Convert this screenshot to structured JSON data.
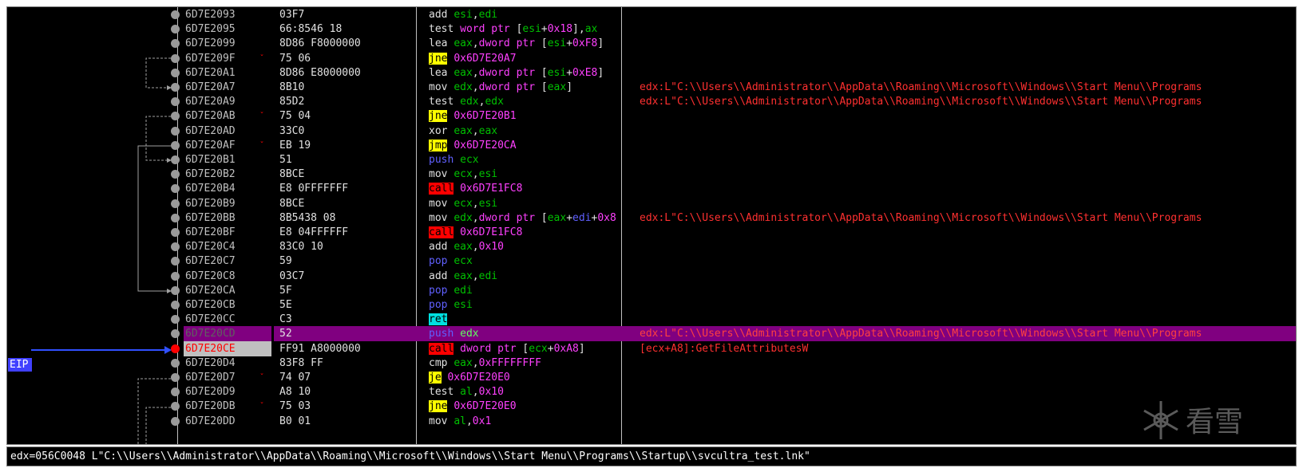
{
  "eip_label": "EIP",
  "watermark_text": "看雪",
  "status_bar": "edx=056C0048 L\"C:\\\\Users\\\\Administrator\\\\AppData\\\\Roaming\\\\Microsoft\\\\Windows\\\\Start Menu\\\\Programs\\\\Startup\\\\svcultra_test.lnk\"",
  "colors": {
    "background": "#000000",
    "selected_row": "#800080",
    "jump_highlight": "#ffff00",
    "call_highlight": "#ff0000",
    "ret_highlight": "#00e0e0",
    "comment": "#ff3030",
    "register": "#00c000",
    "immediate": "#ff40ff"
  },
  "rows": [
    {
      "addr": "6D7E2093",
      "bytes": "03F7",
      "mnemonic": "add",
      "mtype": "plain",
      "ops": [
        [
          "reg",
          "esi"
        ],
        [
          "txt",
          ","
        ],
        [
          "reg",
          "edi"
        ]
      ],
      "comment": ""
    },
    {
      "addr": "6D7E2095",
      "bytes": "66:8546 18",
      "mnemonic": "test",
      "mtype": "plain",
      "ops": [
        [
          "kw",
          "word ptr"
        ],
        [
          "txt",
          " ["
        ],
        [
          "reg",
          "esi"
        ],
        [
          "txt",
          "+"
        ],
        [
          "imm",
          "0x18"
        ],
        [
          "txt",
          "],"
        ],
        [
          "reg",
          "ax"
        ]
      ],
      "comment": ""
    },
    {
      "addr": "6D7E2099",
      "bytes": "8D86 F8000000",
      "mnemonic": "lea",
      "mtype": "plain",
      "ops": [
        [
          "reg",
          "eax"
        ],
        [
          "txt",
          ","
        ],
        [
          "kw",
          "dword ptr"
        ],
        [
          "txt",
          " ["
        ],
        [
          "reg",
          "esi"
        ],
        [
          "txt",
          "+"
        ],
        [
          "imm",
          "0xF8"
        ],
        [
          "txt",
          "]"
        ]
      ],
      "comment": ""
    },
    {
      "addr": "6D7E209F",
      "bytes": "75 06",
      "mnemonic": "jne",
      "mtype": "jcc",
      "jmark": true,
      "ops": [
        [
          "imm",
          "0x6D7E20A7"
        ]
      ],
      "comment": ""
    },
    {
      "addr": "6D7E20A1",
      "bytes": "8D86 E8000000",
      "mnemonic": "lea",
      "mtype": "plain",
      "ops": [
        [
          "reg",
          "eax"
        ],
        [
          "txt",
          ","
        ],
        [
          "kw",
          "dword ptr"
        ],
        [
          "txt",
          " ["
        ],
        [
          "reg",
          "esi"
        ],
        [
          "txt",
          "+"
        ],
        [
          "imm",
          "0xE8"
        ],
        [
          "txt",
          "]"
        ]
      ],
      "comment": ""
    },
    {
      "addr": "6D7E20A7",
      "bytes": "8B10",
      "mnemonic": "mov",
      "mtype": "plain",
      "ops": [
        [
          "reg",
          "edx"
        ],
        [
          "txt",
          ","
        ],
        [
          "kw",
          "dword ptr"
        ],
        [
          "txt",
          " ["
        ],
        [
          "reg",
          "eax"
        ],
        [
          "txt",
          "]"
        ]
      ],
      "comment": "edx:L\"C:\\\\Users\\\\Administrator\\\\AppData\\\\Roaming\\\\Microsoft\\\\Windows\\\\Start Menu\\\\Programs"
    },
    {
      "addr": "6D7E20A9",
      "bytes": "85D2",
      "mnemonic": "test",
      "mtype": "plain",
      "ops": [
        [
          "reg",
          "edx"
        ],
        [
          "txt",
          ","
        ],
        [
          "reg",
          "edx"
        ]
      ],
      "comment": "edx:L\"C:\\\\Users\\\\Administrator\\\\AppData\\\\Roaming\\\\Microsoft\\\\Windows\\\\Start Menu\\\\Programs"
    },
    {
      "addr": "6D7E20AB",
      "bytes": "75 04",
      "mnemonic": "jne",
      "mtype": "jcc",
      "jmark": true,
      "ops": [
        [
          "imm",
          "0x6D7E20B1"
        ]
      ],
      "comment": ""
    },
    {
      "addr": "6D7E20AD",
      "bytes": "33C0",
      "mnemonic": "xor",
      "mtype": "plain",
      "ops": [
        [
          "reg",
          "eax"
        ],
        [
          "txt",
          ","
        ],
        [
          "reg",
          "eax"
        ]
      ],
      "comment": ""
    },
    {
      "addr": "6D7E20AF",
      "bytes": "EB 19",
      "mnemonic": "jmp",
      "mtype": "jmp",
      "jmark": true,
      "ops": [
        [
          "imm",
          "0x6D7E20CA"
        ]
      ],
      "comment": ""
    },
    {
      "addr": "6D7E20B1",
      "bytes": "51",
      "mnemonic": "push",
      "mtype": "stack",
      "ops": [
        [
          "reg",
          "ecx"
        ]
      ],
      "comment": ""
    },
    {
      "addr": "6D7E20B2",
      "bytes": "8BCE",
      "mnemonic": "mov",
      "mtype": "plain",
      "ops": [
        [
          "reg",
          "ecx"
        ],
        [
          "txt",
          ","
        ],
        [
          "reg",
          "esi"
        ]
      ],
      "comment": ""
    },
    {
      "addr": "6D7E20B4",
      "bytes": "E8 0FFFFFFF",
      "mnemonic": "call",
      "mtype": "call",
      "ops": [
        [
          "imm",
          "0x6D7E1FC8"
        ]
      ],
      "comment": ""
    },
    {
      "addr": "6D7E20B9",
      "bytes": "8BCE",
      "mnemonic": "mov",
      "mtype": "plain",
      "ops": [
        [
          "reg",
          "ecx"
        ],
        [
          "txt",
          ","
        ],
        [
          "reg",
          "esi"
        ]
      ],
      "comment": ""
    },
    {
      "addr": "6D7E20BB",
      "bytes": "8B5438 08",
      "mnemonic": "mov",
      "mtype": "plain",
      "ops": [
        [
          "reg",
          "edx"
        ],
        [
          "txt",
          ","
        ],
        [
          "kw",
          "dword ptr"
        ],
        [
          "txt",
          " ["
        ],
        [
          "reg",
          "eax"
        ],
        [
          "txt",
          "+"
        ],
        [
          "stackreg",
          "edi"
        ],
        [
          "txt",
          "+"
        ],
        [
          "imm",
          "0x8"
        ]
      ],
      "comment": "edx:L\"C:\\\\Users\\\\Administrator\\\\AppData\\\\Roaming\\\\Microsoft\\\\Windows\\\\Start Menu\\\\Programs"
    },
    {
      "addr": "6D7E20BF",
      "bytes": "E8 04FFFFFF",
      "mnemonic": "call",
      "mtype": "call",
      "ops": [
        [
          "imm",
          "0x6D7E1FC8"
        ]
      ],
      "comment": ""
    },
    {
      "addr": "6D7E20C4",
      "bytes": "83C0 10",
      "mnemonic": "add",
      "mtype": "plain",
      "ops": [
        [
          "reg",
          "eax"
        ],
        [
          "txt",
          ","
        ],
        [
          "imm",
          "0x10"
        ]
      ],
      "comment": ""
    },
    {
      "addr": "6D7E20C7",
      "bytes": "59",
      "mnemonic": "pop",
      "mtype": "stack",
      "ops": [
        [
          "reg",
          "ecx"
        ]
      ],
      "comment": ""
    },
    {
      "addr": "6D7E20C8",
      "bytes": "03C7",
      "mnemonic": "add",
      "mtype": "plain",
      "ops": [
        [
          "reg",
          "eax"
        ],
        [
          "txt",
          ","
        ],
        [
          "reg",
          "edi"
        ]
      ],
      "comment": ""
    },
    {
      "addr": "6D7E20CA",
      "bytes": "5F",
      "mnemonic": "pop",
      "mtype": "stack",
      "ops": [
        [
          "reg",
          "edi"
        ]
      ],
      "comment": ""
    },
    {
      "addr": "6D7E20CB",
      "bytes": "5E",
      "mnemonic": "pop",
      "mtype": "stack",
      "ops": [
        [
          "reg",
          "esi"
        ]
      ],
      "comment": ""
    },
    {
      "addr": "6D7E20CC",
      "bytes": "C3",
      "mnemonic": "ret",
      "mtype": "ret",
      "ops": [],
      "comment": ""
    },
    {
      "addr": "6D7E20CD",
      "bytes": "52",
      "mnemonic": "push",
      "mtype": "stack",
      "state": "selected",
      "ops": [
        [
          "reg",
          "edx"
        ]
      ],
      "comment": "edx:L\"C:\\\\Users\\\\Administrator\\\\AppData\\\\Roaming\\\\Microsoft\\\\Windows\\\\Start Menu\\\\Programs"
    },
    {
      "addr": "6D7E20CE",
      "bytes": "FF91 A8000000",
      "mnemonic": "call",
      "mtype": "call",
      "state": "eip",
      "ops": [
        [
          "kw",
          "dword ptr"
        ],
        [
          "txt",
          " ["
        ],
        [
          "reg",
          "ecx"
        ],
        [
          "txt",
          "+"
        ],
        [
          "imm",
          "0xA8"
        ],
        [
          "txt",
          "]"
        ]
      ],
      "comment": "[ecx+A8]:GetFileAttributesW"
    },
    {
      "addr": "6D7E20D4",
      "bytes": "83F8 FF",
      "mnemonic": "cmp",
      "mtype": "plain",
      "ops": [
        [
          "reg",
          "eax"
        ],
        [
          "txt",
          ","
        ],
        [
          "imm",
          "0xFFFFFFFF"
        ]
      ],
      "comment": ""
    },
    {
      "addr": "6D7E20D7",
      "bytes": "74 07",
      "mnemonic": "je",
      "mtype": "jcc",
      "jmark": true,
      "ops": [
        [
          "imm",
          "0x6D7E20E0"
        ]
      ],
      "comment": ""
    },
    {
      "addr": "6D7E20D9",
      "bytes": "A8 10",
      "mnemonic": "test",
      "mtype": "plain",
      "ops": [
        [
          "reg",
          "al"
        ],
        [
          "txt",
          ","
        ],
        [
          "imm",
          "0x10"
        ]
      ],
      "comment": ""
    },
    {
      "addr": "6D7E20DB",
      "bytes": "75 03",
      "mnemonic": "jne",
      "mtype": "jcc",
      "jmark": true,
      "ops": [
        [
          "imm",
          "0x6D7E20E0"
        ]
      ],
      "comment": ""
    },
    {
      "addr": "6D7E20DD",
      "bytes": "B0 01",
      "mnemonic": "mov",
      "mtype": "plain",
      "ops": [
        [
          "reg",
          "al"
        ],
        [
          "txt",
          ","
        ],
        [
          "imm",
          "0x1"
        ]
      ],
      "comment": ""
    }
  ]
}
